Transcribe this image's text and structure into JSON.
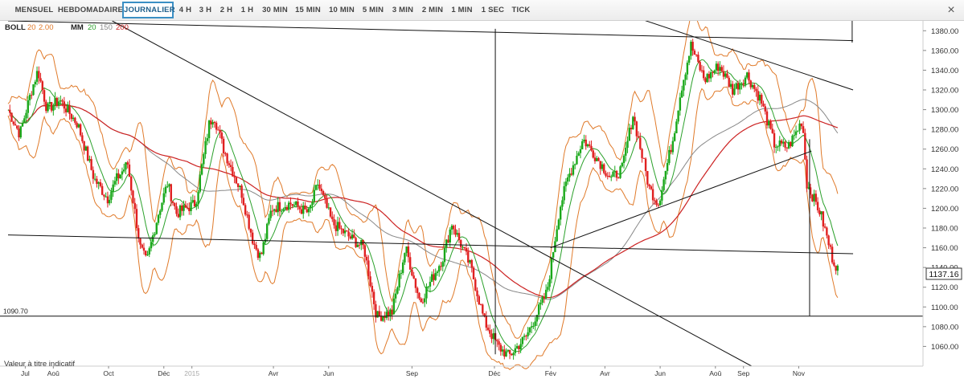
{
  "toolbar": {
    "buttons": [
      {
        "label": "MENSUEL",
        "active": false
      },
      {
        "label": "HEBDOMADAIRE",
        "active": false
      },
      {
        "label": "JOURNALIER",
        "active": true
      },
      {
        "label": "4 H",
        "active": false
      },
      {
        "label": "3 H",
        "active": false
      },
      {
        "label": "2 H",
        "active": false
      },
      {
        "label": "1 H",
        "active": false
      },
      {
        "label": "30 MIN",
        "active": false
      },
      {
        "label": "15 MIN",
        "active": false
      },
      {
        "label": "10 MIN",
        "active": false
      },
      {
        "label": "5 MIN",
        "active": false
      },
      {
        "label": "3 MIN",
        "active": false
      },
      {
        "label": "2 MIN",
        "active": false
      },
      {
        "label": "1 MIN",
        "active": false
      },
      {
        "label": "1 SEC",
        "active": false
      },
      {
        "label": "TICK",
        "active": false
      }
    ],
    "close_icon": "close-icon"
  },
  "indicators": {
    "boll_name": "BOLL",
    "boll_period": "20",
    "boll_dev": "2.00",
    "mm_name": "MM",
    "mm_p1": "20",
    "mm_p2": "150",
    "mm_p3": "200"
  },
  "disclaimer": "Valeur à titre indicatif",
  "colors": {
    "up": "#1aa81a",
    "down": "#e02020",
    "boll": "#e07a2a",
    "mm20": "#2aa02a",
    "mm150": "#888888",
    "mm200": "#cc2222",
    "trend": "#111111"
  },
  "chart_data": {
    "type": "candlestick",
    "y_axis": {
      "ylim": [
        1040,
        1390
      ],
      "ticks": [
        1060,
        1080,
        1100,
        1120,
        1140,
        1160,
        1180,
        1200,
        1220,
        1240,
        1260,
        1280,
        1300,
        1320,
        1340,
        1360,
        1380
      ]
    },
    "x_axis": {
      "range": [
        "2014-06-12",
        "2016-01-10"
      ],
      "ticks": [
        {
          "label": "Jul",
          "date": "2014-07-01"
        },
        {
          "label": "Aoû",
          "date": "2014-08-01"
        },
        {
          "label": "Oct",
          "date": "2014-10-01"
        },
        {
          "label": "Déc",
          "date": "2014-12-01"
        },
        {
          "label": "2015",
          "date": "2015-01-01"
        },
        {
          "label": "Avr",
          "date": "2015-04-01"
        },
        {
          "label": "Jun",
          "date": "2015-06-01"
        },
        {
          "label": "Sep",
          "date": "2015-09-01"
        },
        {
          "label": "Déc",
          "date": "2015-12-01"
        },
        {
          "label": "Fév",
          "date": "2016-02-01"
        },
        {
          "label": "Avr",
          "date": "2016-04-01"
        },
        {
          "label": "Jun",
          "date": "2016-06-01"
        },
        {
          "label": "Aoû",
          "date": "2016-08-01"
        },
        {
          "label": "Sep",
          "date": "2016-09-01"
        },
        {
          "label": "Nov",
          "date": "2016-11-01"
        }
      ]
    },
    "price_path": [
      [
        "2014-06-12",
        1300
      ],
      [
        "2014-06-25",
        1275
      ],
      [
        "2014-07-08",
        1320
      ],
      [
        "2014-07-15",
        1340
      ],
      [
        "2014-07-25",
        1300
      ],
      [
        "2014-08-08",
        1310
      ],
      [
        "2014-08-28",
        1285
      ],
      [
        "2014-09-15",
        1230
      ],
      [
        "2014-09-30",
        1210
      ],
      [
        "2014-10-10",
        1230
      ],
      [
        "2014-10-22",
        1245
      ],
      [
        "2014-11-05",
        1160
      ],
      [
        "2014-11-12",
        1145
      ],
      [
        "2014-11-25",
        1195
      ],
      [
        "2014-12-05",
        1225
      ],
      [
        "2014-12-15",
        1195
      ],
      [
        "2015-01-05",
        1205
      ],
      [
        "2015-01-20",
        1285
      ],
      [
        "2015-01-25",
        1295
      ],
      [
        "2015-02-05",
        1260
      ],
      [
        "2015-02-25",
        1215
      ],
      [
        "2015-03-10",
        1165
      ],
      [
        "2015-03-18",
        1150
      ],
      [
        "2015-03-30",
        1200
      ],
      [
        "2015-04-20",
        1205
      ],
      [
        "2015-05-10",
        1195
      ],
      [
        "2015-05-20",
        1225
      ],
      [
        "2015-06-05",
        1185
      ],
      [
        "2015-06-25",
        1170
      ],
      [
        "2015-07-10",
        1160
      ],
      [
        "2015-07-24",
        1090
      ],
      [
        "2015-08-10",
        1095
      ],
      [
        "2015-08-25",
        1160
      ],
      [
        "2015-09-10",
        1105
      ],
      [
        "2015-10-05",
        1150
      ],
      [
        "2015-10-15",
        1185
      ],
      [
        "2015-11-05",
        1140
      ],
      [
        "2015-11-20",
        1085
      ],
      [
        "2015-12-05",
        1060
      ],
      [
        "2015-12-17",
        1050
      ],
      [
        "2016-01-05",
        1070
      ],
      [
        "2016-01-28",
        1115
      ],
      [
        "2016-02-11",
        1200
      ],
      [
        "2016-02-20",
        1230
      ],
      [
        "2016-03-08",
        1270
      ],
      [
        "2016-03-20",
        1255
      ],
      [
        "2016-04-08",
        1230
      ],
      [
        "2016-04-20",
        1240
      ],
      [
        "2016-05-02",
        1295
      ],
      [
        "2016-05-20",
        1220
      ],
      [
        "2016-05-30",
        1205
      ],
      [
        "2016-06-15",
        1270
      ],
      [
        "2016-06-24",
        1320
      ],
      [
        "2016-07-05",
        1365
      ],
      [
        "2016-07-20",
        1330
      ],
      [
        "2016-08-05",
        1345
      ],
      [
        "2016-08-20",
        1320
      ],
      [
        "2016-09-05",
        1335
      ],
      [
        "2016-09-20",
        1310
      ],
      [
        "2016-10-05",
        1265
      ],
      [
        "2016-10-20",
        1262
      ],
      [
        "2016-10-28",
        1275
      ],
      [
        "2016-11-05",
        1290
      ],
      [
        "2016-11-10",
        1225
      ],
      [
        "2016-11-25",
        1195
      ],
      [
        "2016-12-08",
        1150
      ],
      [
        "2016-12-15",
        1137
      ]
    ],
    "last_price": "1137.16",
    "support_label": "1090.70",
    "support_level": 1090.7,
    "trend_lines": [
      {
        "from": [
          "2014-06-12",
          1390
        ],
        "to": [
          "2016-12-31",
          1370
        ]
      },
      {
        "from": [
          "2014-10-05",
          1390
        ],
        "to": [
          "2016-09-10",
          1040
        ]
      },
      {
        "from": [
          "2014-06-12",
          1173
        ],
        "to": [
          "2016-12-31",
          1154
        ]
      },
      {
        "from": [
          "2016-02-01",
          1160
        ],
        "to": [
          "2016-11-15",
          1258
        ]
      },
      {
        "from": [
          "2016-05-10",
          1392
        ],
        "to": [
          "2016-12-31",
          1320
        ]
      }
    ],
    "vertical_lines": [
      {
        "date": "2015-12-02",
        "from": 1052,
        "to": 1382
      },
      {
        "date": "2016-11-13",
        "from": 1091,
        "to": 1270
      },
      {
        "date": "2016-12-30",
        "from": 1368,
        "to": 1392
      }
    ]
  }
}
